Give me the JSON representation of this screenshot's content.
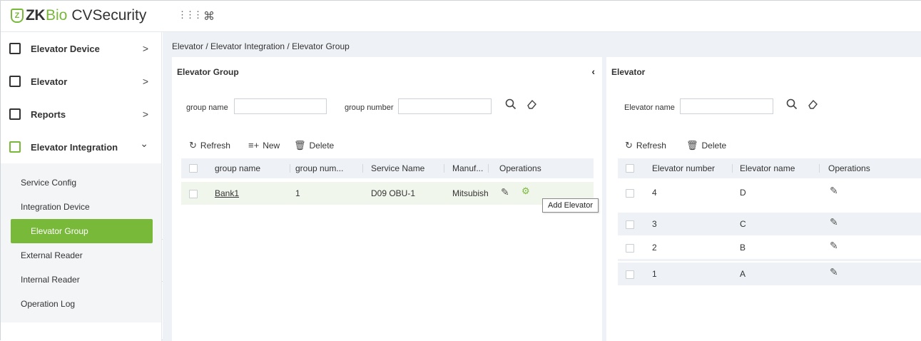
{
  "app": {
    "logo_mark": "Z",
    "logo_zk": "ZK",
    "logo_bio": "Bio",
    "logo_product": "CVSecurity",
    "apps_icon": "⋮⋮⋮",
    "command_icon": "⌘"
  },
  "sidebar": {
    "items": [
      {
        "label": "Elevator Device",
        "arrow": ">",
        "icon": "elevator-device-icon"
      },
      {
        "label": "Elevator",
        "arrow": ">",
        "icon": "elevator-icon"
      },
      {
        "label": "Reports",
        "arrow": ">",
        "icon": "reports-icon"
      },
      {
        "label": "Elevator Integration",
        "arrow": "⌄",
        "icon": "elevator-integration-icon"
      }
    ],
    "subitems": [
      {
        "label": "Service Config",
        "active": false
      },
      {
        "label": "Integration Device",
        "active": false
      },
      {
        "label": "Elevator Group",
        "active": true
      },
      {
        "label": "External Reader",
        "active": false
      },
      {
        "label": "Internal Reader",
        "active": false
      },
      {
        "label": "Operation Log",
        "active": false
      }
    ],
    "collapse_glyph": "«"
  },
  "breadcrumb": "Elevator / Elevator Integration / Elevator Group",
  "left_panel": {
    "title": "Elevator Group",
    "collapse_glyph": "‹",
    "filter_group_name_label": "group name",
    "filter_group_name_value": "",
    "filter_group_number_label": "group number",
    "filter_group_number_value": "",
    "toolbar": {
      "refresh": "Refresh",
      "new": "New",
      "delete": "Delete"
    },
    "columns": [
      "group name",
      "group num...",
      "Service Name",
      "Manuf...",
      "Operations"
    ],
    "rows": [
      {
        "group_name": "Bank1",
        "group_number": "1",
        "service_name": "D09 OBU-1",
        "manufacturer": "Mitsubish"
      }
    ],
    "tooltip": "Add Elevator"
  },
  "right_panel": {
    "title": "Elevator",
    "filter_elevator_name_label": "Elevator name",
    "filter_elevator_name_value": "",
    "toolbar": {
      "refresh": "Refresh",
      "delete": "Delete"
    },
    "columns": [
      "Elevator number",
      "Elevator name",
      "Operations"
    ],
    "rows": [
      {
        "number": "4",
        "name": "D"
      },
      {
        "number": "3",
        "name": "C"
      },
      {
        "number": "2",
        "name": "B"
      },
      {
        "number": "1",
        "name": "A"
      }
    ]
  },
  "colors": {
    "accent": "#79b93a",
    "row_highlight": "#f1f6ec",
    "row_alt": "#eef1f5"
  }
}
